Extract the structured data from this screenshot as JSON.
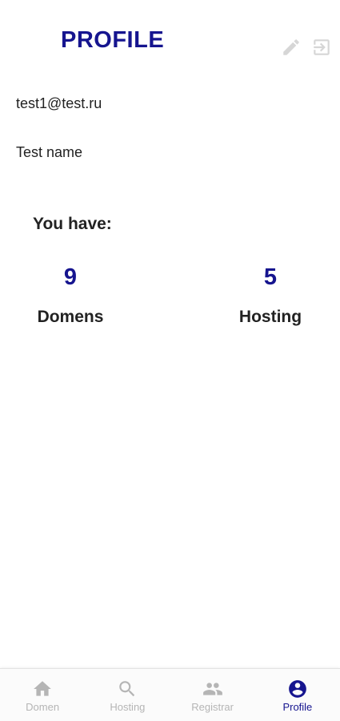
{
  "header": {
    "title": "PROFILE",
    "actions": [
      {
        "icon": "edit-icon"
      },
      {
        "icon": "exit-icon"
      }
    ]
  },
  "user": {
    "email": "test1@test.ru",
    "name": "Test name"
  },
  "summary": {
    "heading": "You have:",
    "stats": [
      {
        "value": "9",
        "label": "Domens"
      },
      {
        "value": "5",
        "label": "Hosting"
      }
    ]
  },
  "bottom_nav": {
    "items": [
      {
        "label": "Domen",
        "icon": "home-icon",
        "active": false
      },
      {
        "label": "Hosting",
        "icon": "search-icon",
        "active": false
      },
      {
        "label": "Registrar",
        "icon": "people-icon",
        "active": false
      },
      {
        "label": "Profile",
        "icon": "account-circle-icon",
        "active": true
      }
    ]
  },
  "colors": {
    "accent": "#16158f",
    "text": "#222222",
    "inactive": "#b5b5b5",
    "icon_light": "#d6d6d6"
  }
}
